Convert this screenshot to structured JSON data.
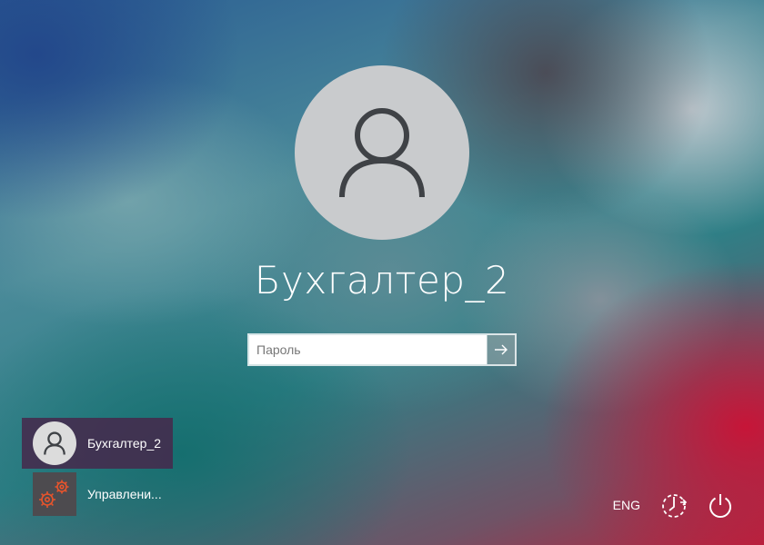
{
  "login": {
    "username": "Бухгалтер_2",
    "password_placeholder": "Пароль",
    "password_value": ""
  },
  "user_list": [
    {
      "label": "Бухгалтер_2",
      "icon": "user-icon",
      "selected": true
    },
    {
      "label": "Управлени...",
      "icon": "gears-icon",
      "selected": false
    }
  ],
  "system": {
    "language": "ENG",
    "ease_of_access_icon": "network-icon",
    "power_icon": "power-icon"
  },
  "colors": {
    "selected_user_bg": "#46284b",
    "gear_accent": "#e8542c"
  }
}
